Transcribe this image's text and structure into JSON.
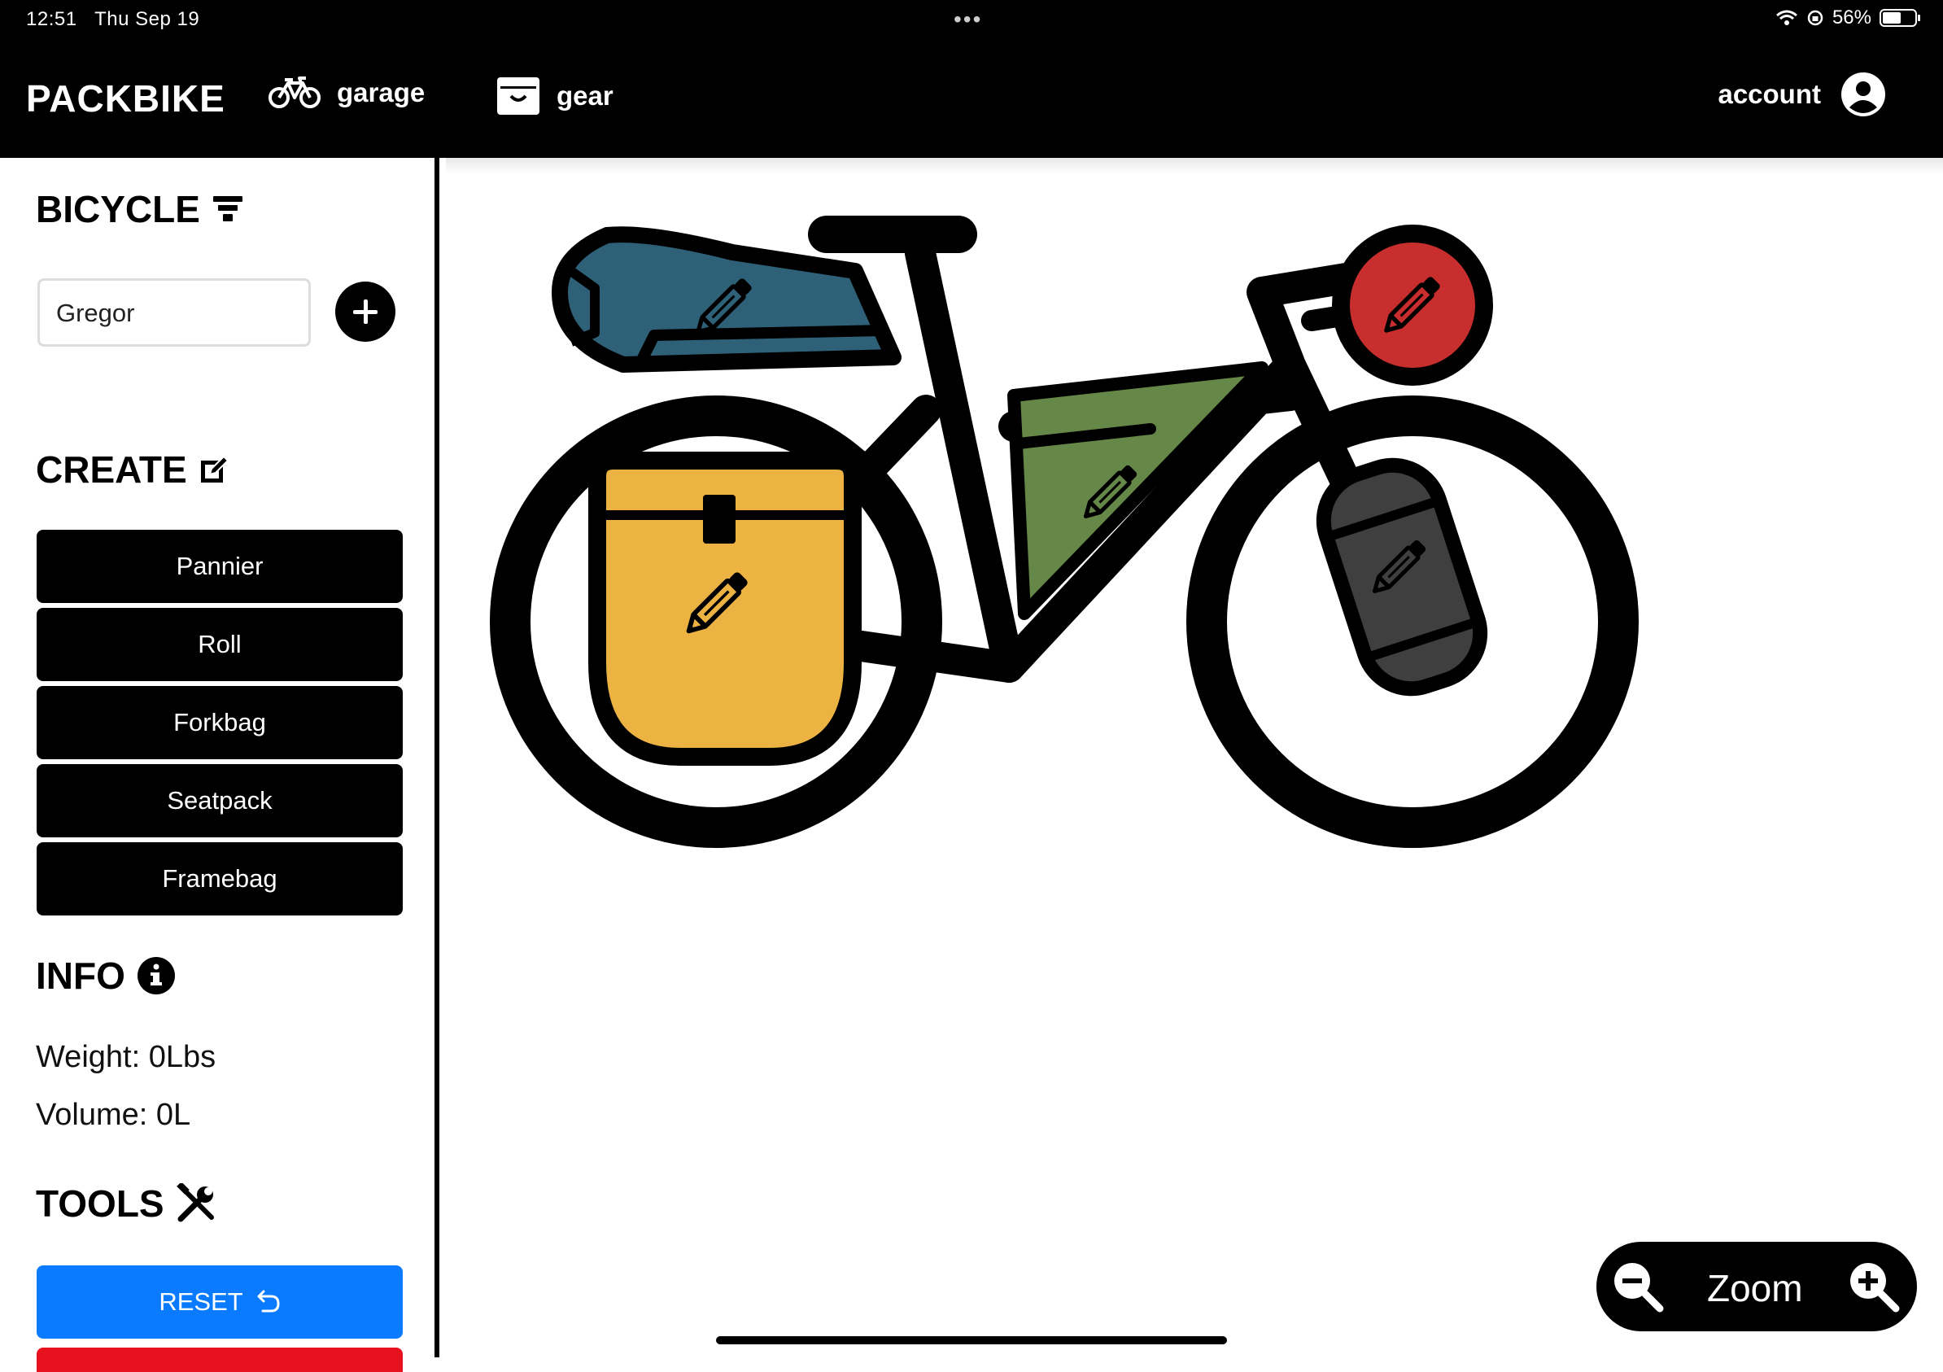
{
  "status_bar": {
    "time": "12:51",
    "date": "Thu Sep 19",
    "battery": "56%"
  },
  "nav": {
    "brand": "PACKBIKE",
    "garage_label": "garage",
    "gear_label": "gear",
    "account_label": "account"
  },
  "sidebar": {
    "bicycle_title": "BICYCLE",
    "bike_select_value": "Gregor",
    "create_title": "CREATE",
    "create_buttons": [
      "Pannier",
      "Roll",
      "Forkbag",
      "Seatpack",
      "Framebag"
    ],
    "info_title": "INFO",
    "weight": "Weight: 0Lbs",
    "volume": "Volume: 0L",
    "tools_title": "TOOLS",
    "reset_label": "RESET"
  },
  "zoom": {
    "label": "Zoom"
  },
  "colors": {
    "seatpack": "#2e6177",
    "framebag": "#658748",
    "pannier": "#edb342",
    "forkbag": "#3f3f3f",
    "roll": "#c82e2e",
    "reset": "#0a7bff"
  },
  "icons": [
    "bike-icon",
    "basket-icon",
    "account-icon",
    "filter-icon",
    "edit-square-icon",
    "info-icon",
    "tools-icon",
    "undo-icon",
    "pencil-icon",
    "zoom-in-icon",
    "zoom-out-icon",
    "wifi-icon",
    "battery-icon"
  ]
}
